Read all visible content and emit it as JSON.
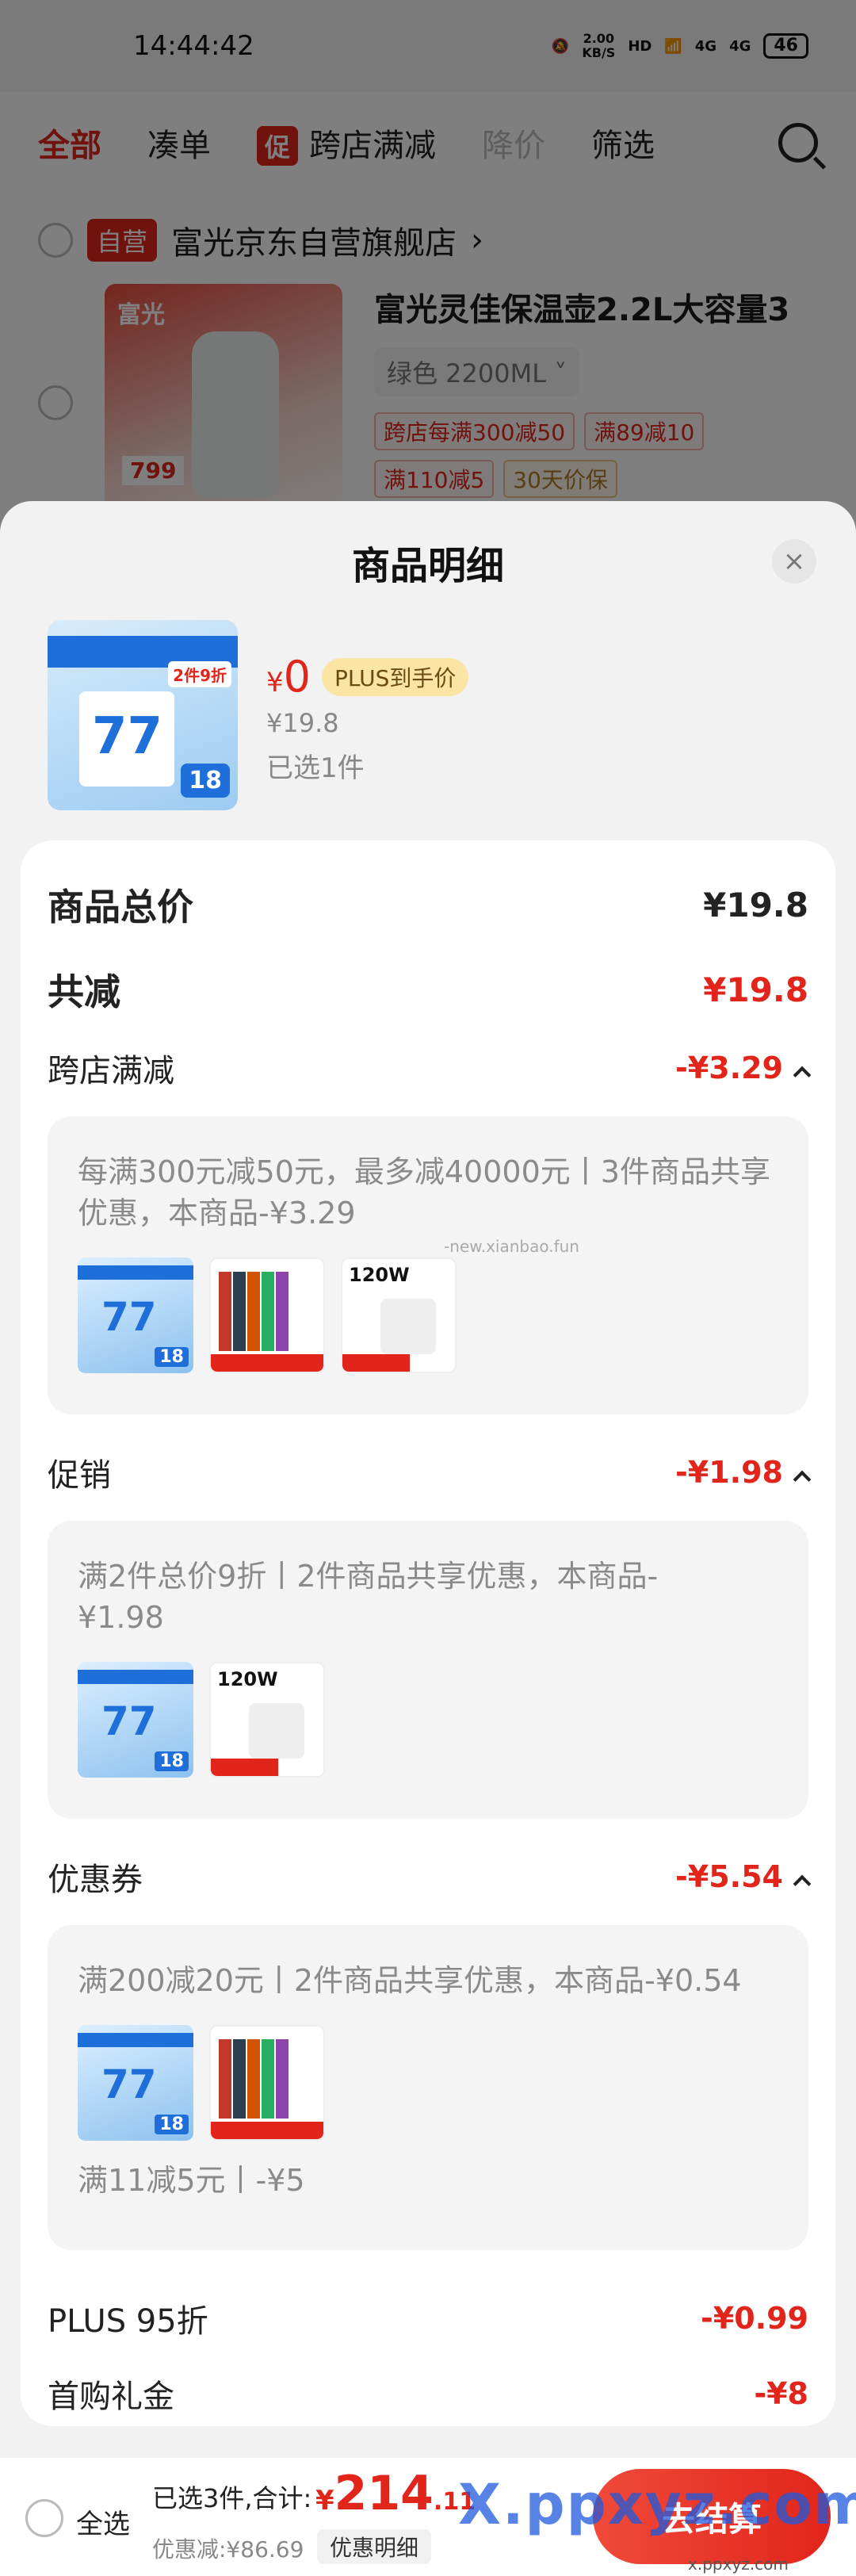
{
  "status_bar": {
    "time": "14:44:42",
    "net_speed_top": "2.00",
    "net_speed_unit": "KB/S",
    "hd_label": "HD",
    "signal_1": "4G",
    "signal_2": "4G",
    "battery": "46"
  },
  "top_tabs": {
    "all": "全部",
    "bundle": "凑单",
    "promo_badge": "促",
    "cross_store": "跨店满减",
    "price_drop": "降价",
    "filter": "筛选"
  },
  "store": {
    "badge": "自营",
    "name": "富光京东自营旗舰店",
    "product_title": "富光灵佳保温壶2.2L大容量3",
    "variant": "绿色 2200ML",
    "image_brand": "富光",
    "image_price": "799",
    "chips": [
      "跨店每满300减50",
      "满89减10",
      "满110减5",
      "30天价保"
    ]
  },
  "sheet": {
    "title": "商品明细",
    "close": "×",
    "product": {
      "currency": "¥",
      "now_price": "0",
      "plus_label": "PLUS到手价",
      "original_price": "¥19.8",
      "selected": "已选1件",
      "thumb_number": "77",
      "thumb_discount": "2件9折",
      "thumb_price": "18"
    },
    "total_label": "商品总价",
    "total_value": "¥19.8",
    "reduce_label": "共减",
    "reduce_value": "¥19.8",
    "sections": [
      {
        "label": "跨店满减",
        "value": "-¥3.29",
        "text": "每满300元减50元，最多减40000元丨3件商品共享优惠，本商品-¥3.29"
      },
      {
        "label": "促销",
        "value": "-¥1.98",
        "text": "满2件总价9折丨2件商品共享优惠，本商品-¥1.98"
      },
      {
        "label": "优惠券",
        "value": "-¥5.54",
        "text": "满200减20元丨2件商品共享优惠，本商品-¥0.54",
        "extra": "满11减5元丨-¥5"
      }
    ],
    "plus_label": "PLUS 95折",
    "plus_value": "-¥0.99",
    "first_label": "首购礼金",
    "first_value": "-¥8",
    "mini_charger_text": "120W",
    "mini_paste_text": "77",
    "mini_paste_price": "18",
    "watermark_mid": "-new.xianbao.fun"
  },
  "bottom_bar": {
    "select_all": "全选",
    "summary": "已选3件,合计:",
    "currency": "¥",
    "total_int": "214",
    "total_cents": ".11",
    "discount": "优惠减:¥86.69",
    "detail_button": "优惠明细",
    "checkout": "去结算",
    "watermark": "X.ppxyz.com",
    "watermark_small": "x.ppxyz.com"
  }
}
